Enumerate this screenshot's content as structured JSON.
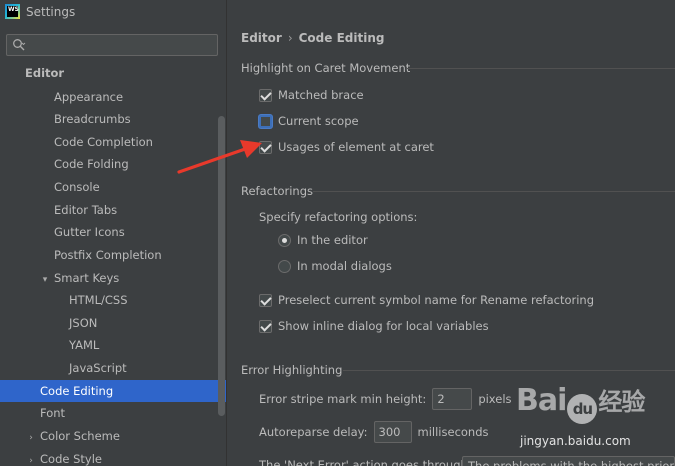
{
  "window": {
    "title": "Settings",
    "app_logo": "WS"
  },
  "search": {
    "value": "",
    "placeholder": ""
  },
  "sidebar": {
    "items": [
      {
        "label": "Editor"
      },
      {
        "label": "Appearance"
      },
      {
        "label": "Breadcrumbs"
      },
      {
        "label": "Code Completion"
      },
      {
        "label": "Code Folding"
      },
      {
        "label": "Console"
      },
      {
        "label": "Editor Tabs"
      },
      {
        "label": "Gutter Icons"
      },
      {
        "label": "Postfix Completion"
      },
      {
        "label": "Smart Keys"
      },
      {
        "label": "HTML/CSS"
      },
      {
        "label": "JSON"
      },
      {
        "label": "YAML"
      },
      {
        "label": "JavaScript"
      },
      {
        "label": "Code Editing"
      },
      {
        "label": "Font"
      },
      {
        "label": "Color Scheme"
      },
      {
        "label": "Code Style"
      }
    ],
    "selected": "Code Editing"
  },
  "breadcrumb": {
    "parent": "Editor",
    "separator": "›",
    "current": "Code Editing"
  },
  "highlight_section": {
    "title": "Highlight on Caret Movement",
    "options": [
      {
        "label": "Matched brace",
        "checked": true
      },
      {
        "label": "Current scope",
        "checked": false
      },
      {
        "label": "Usages of element at caret",
        "checked": true
      }
    ]
  },
  "refactorings_section": {
    "title": "Refactorings",
    "specify_label": "Specify refactoring options:",
    "radios": [
      {
        "label": "In the editor",
        "selected": true
      },
      {
        "label": "In modal dialogs",
        "selected": false
      }
    ],
    "checks": [
      {
        "label": "Preselect current symbol name for Rename refactoring",
        "checked": true
      },
      {
        "label": "Show inline dialog for local variables",
        "checked": true
      }
    ]
  },
  "error_section": {
    "title": "Error Highlighting",
    "stripe_label": "Error stripe mark min height:",
    "stripe_value": "2",
    "stripe_unit": "pixels",
    "autoreparse_label": "Autoreparse delay:",
    "autoreparse_value": "300",
    "autoreparse_unit": "milliseconds",
    "next_error_label": "The 'Next Error' action goes through:",
    "next_error_value": "The problems with the highest priority"
  },
  "watermark": {
    "logo_text_1": "Bai",
    "logo_paw": "du",
    "logo_text_2": "经验",
    "url": "jingyan.baidu.com"
  },
  "colors": {
    "background": "#3c3f41",
    "selection": "#2f65ca",
    "annotation_arrow": "#e8392b"
  }
}
